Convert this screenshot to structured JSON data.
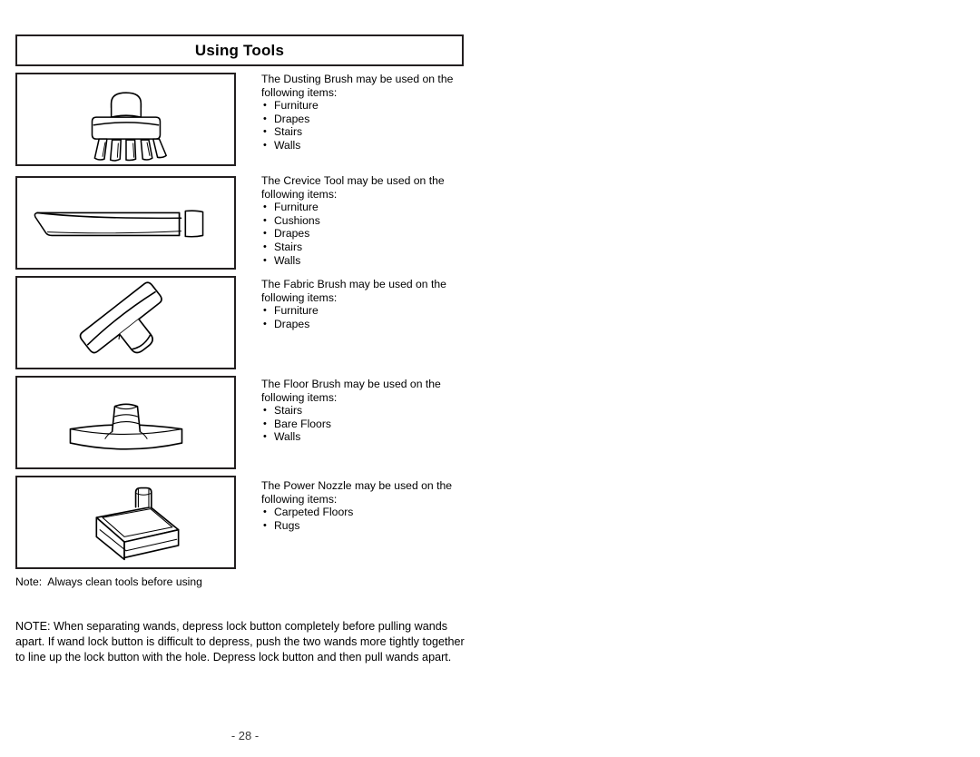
{
  "page": {
    "title": "Using Tools",
    "number_label": "- 28 -"
  },
  "figures": [
    {
      "name": "dusting-brush-illustration",
      "alt": "Dusting Brush"
    },
    {
      "name": "crevice-tool-illustration",
      "alt": "Crevice Tool"
    },
    {
      "name": "fabric-brush-illustration",
      "alt": "Fabric Brush"
    },
    {
      "name": "floor-brush-illustration",
      "alt": "Floor Brush"
    },
    {
      "name": "power-nozzle-illustration",
      "alt": "Power Nozzle"
    }
  ],
  "tool_blocks": [
    {
      "intro": "The Dusting Brush may be used on the following items:",
      "items": [
        "Furniture",
        "Drapes",
        "Stairs",
        "Walls"
      ]
    },
    {
      "intro": "The Crevice Tool may be used on the following items:",
      "items": [
        "Furniture",
        "Cushions",
        "Drapes",
        "Stairs",
        "Walls"
      ]
    },
    {
      "intro": "The Fabric Brush may be used on the following items:",
      "items": [
        "Furniture",
        "Drapes"
      ]
    },
    {
      "intro": "The Floor Brush may be used on the following items:",
      "items": [
        "Stairs",
        "Bare Floors",
        "Walls"
      ]
    },
    {
      "intro": "The Power Nozzle may be used on the following items:",
      "items": [
        "Carpeted Floors",
        "Rugs"
      ]
    }
  ],
  "tools_note": "Note:  Always clean tools before using",
  "bottom_note": "NOTE: When separating wands, depress lock button completely before pulling wands apart. If wand lock button is difficult to depress, push the two wands more tightly together to line up the lock button with the hole. Depress lock button and then pull wands apart.",
  "colors": {
    "ink": "#231f20",
    "page_background": "#ffffff",
    "page_number": "#3a3a3a"
  }
}
